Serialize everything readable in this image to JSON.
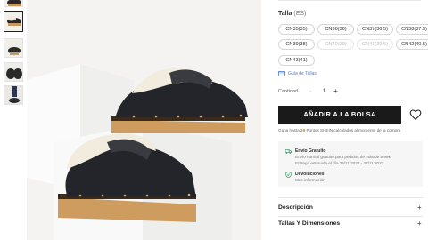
{
  "gallery": {
    "thumbnail_count": 6,
    "active_index": 1
  },
  "size_section": {
    "label": "Talla",
    "region": "(ES)",
    "sizes": [
      {
        "label": "CN35(35)",
        "available": true
      },
      {
        "label": "CN36(36)",
        "available": true
      },
      {
        "label": "CN37(36.5)",
        "available": true
      },
      {
        "label": "CN38(37.5)",
        "available": true
      },
      {
        "label": "CN39(38)",
        "available": true
      },
      {
        "label": "CN40(39)",
        "available": false
      },
      {
        "label": "CN41(39.5)",
        "available": false
      },
      {
        "label": "CN42(40.5)",
        "available": true
      },
      {
        "label": "CN43(41)",
        "available": true
      }
    ],
    "size_guide": "Guía de Tallas"
  },
  "quantity": {
    "label": "Cantidad",
    "minus": "-",
    "value": "1",
    "plus": "+"
  },
  "add_to_bag": "AÑADIR A LA BOLSA",
  "points": {
    "prefix": "Gana hasta",
    "amount": "26",
    "suffix": "Puntos SHEIN calculados al momento de la compra"
  },
  "shipping": {
    "free_title": "Envío Gratuito",
    "free_line1": "Envío normal gratuito para pedidos de más de 9.99€",
    "free_line2": "Entrega estimada el día 25/11/2022 - 27/11/2022",
    "returns_title": "Devoluciones",
    "returns_line": "Más información"
  },
  "accordions": [
    {
      "label": "Descripción",
      "icon": "+"
    },
    {
      "label": "Tallas Y Dimensiones",
      "icon": "+"
    }
  ],
  "colors": {
    "accent_button": "#1a1a1a",
    "link": "#4a7ad6",
    "points": "#c47b10",
    "shipping_icon": "#3c9c6a"
  }
}
